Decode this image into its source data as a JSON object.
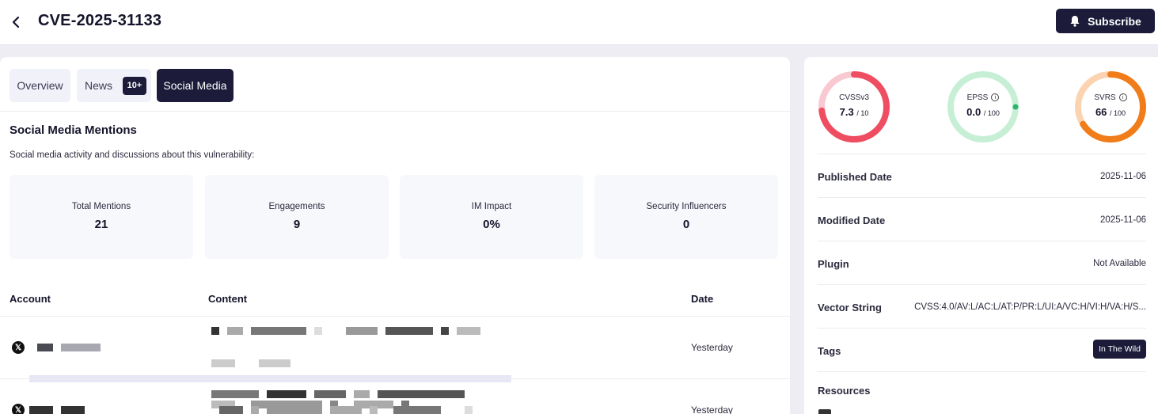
{
  "header": {
    "title": "CVE-2025-31133",
    "subscribe_label": "Subscribe"
  },
  "tabs": [
    {
      "label": "Overview"
    },
    {
      "label": "News",
      "badge": "10+"
    },
    {
      "label": "Social Media"
    }
  ],
  "section": {
    "title": "Social Media Mentions",
    "description": "Social media activity and discussions about this vulnerability:"
  },
  "stats": [
    {
      "label": "Total Mentions",
      "value": "21"
    },
    {
      "label": "Engagements",
      "value": "9"
    },
    {
      "label": "IM Impact",
      "value": "0%"
    },
    {
      "label": "Security Influencers",
      "value": "0"
    }
  ],
  "table": {
    "columns": [
      "Account",
      "Content",
      "Date"
    ],
    "rows": [
      {
        "date": "Yesterday"
      },
      {
        "date": "Yesterday"
      }
    ]
  },
  "gauges": [
    {
      "label": "CVSSv3",
      "value": "7.3",
      "max": "/ 10",
      "fraction": 0.73,
      "color": "#ee4d62",
      "track": "#f9c9d1"
    },
    {
      "label": "EPSS",
      "value": "0.0",
      "max": "/ 100",
      "fraction": 0.0,
      "color": "#2db56c",
      "track": "#c7efd6"
    },
    {
      "label": "SVRS",
      "value": "66",
      "max": "/ 100",
      "fraction": 0.66,
      "color": "#f07c1a",
      "track": "#fbd3b0"
    }
  ],
  "details": {
    "published_label": "Published Date",
    "published_value": "2025-11-06",
    "modified_label": "Modified Date",
    "modified_value": "2025-11-06",
    "plugin_label": "Plugin",
    "plugin_value": "Not Available",
    "vector_label": "Vector String",
    "vector_value": "CVSS:4.0/AV:L/AC:L/AT:P/PR:L/UI:A/VC:H/VI:H/VA:H/S...",
    "tags_label": "Tags",
    "tag_value": "In The Wild",
    "resources_label": "Resources"
  },
  "colors": {
    "accent": "#1c1b3a",
    "page_bg": "#ededf3"
  }
}
